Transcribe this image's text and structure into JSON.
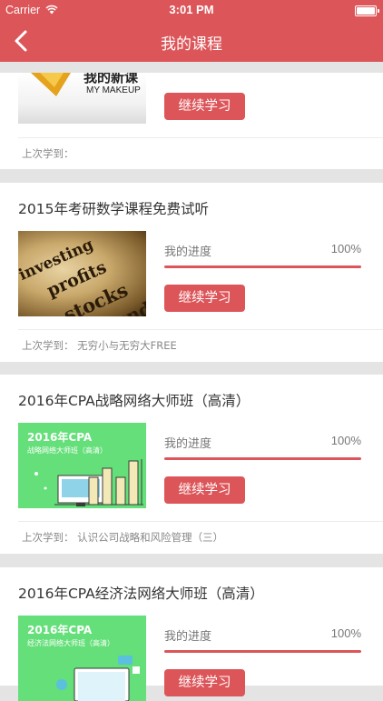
{
  "status_bar": {
    "carrier": "Carrier",
    "time": "3:01 PM"
  },
  "nav": {
    "title": "我的课程"
  },
  "colors": {
    "accent": "#dc5559",
    "cpa_green": "#64df79"
  },
  "courses": [
    {
      "title": "",
      "thumb_text": [
        "我的新课",
        "MY MAKEUP"
      ],
      "button": "继续学习",
      "last_studied": "上次学到："
    },
    {
      "title": "2015年考研数学课程免费试听",
      "thumb_text": [
        "investing",
        "profits",
        "stocks",
        "funds"
      ],
      "progress_label": "我的进度",
      "progress": "100%",
      "button": "继续学习",
      "last_studied": "上次学到： 无穷小与无穷大FREE"
    },
    {
      "title": "2016年CPA战略网络大师班（高清）",
      "thumb_text": [
        "2016年CPA",
        "战略网络大师班（高清）"
      ],
      "progress_label": "我的进度",
      "progress": "100%",
      "button": "继续学习",
      "last_studied": "上次学到： 认识公司战略和风险管理（三）"
    },
    {
      "title": "2016年CPA经济法网络大师班（高清）",
      "thumb_text": [
        "2016年CPA",
        "经济法网络大师班（高清）"
      ],
      "progress_label": "我的进度",
      "progress": "100%",
      "button": "继续学习",
      "last_studied": ""
    }
  ]
}
